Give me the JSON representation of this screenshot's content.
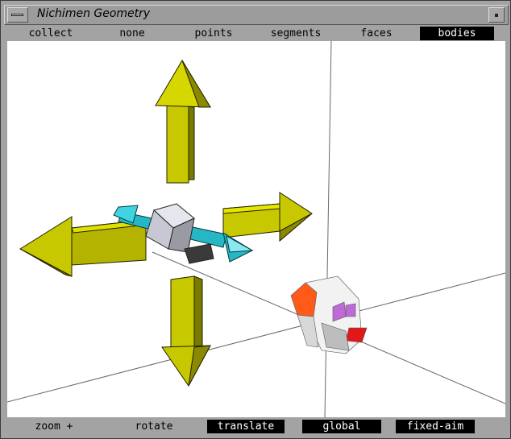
{
  "window": {
    "title": "Nichimen Geometry"
  },
  "select_bar": [
    {
      "label": "collect",
      "active": false
    },
    {
      "label": "none",
      "active": false
    },
    {
      "label": "points",
      "active": false
    },
    {
      "label": "segments",
      "active": false
    },
    {
      "label": "faces",
      "active": false
    },
    {
      "label": "bodies",
      "active": true
    }
  ],
  "mode_bar": [
    {
      "label": "zoom +",
      "active": false
    },
    {
      "label": "rotate",
      "active": false
    },
    {
      "label": "translate",
      "active": true
    },
    {
      "label": "global",
      "active": true
    },
    {
      "label": "fixed-aim",
      "active": true
    }
  ],
  "colors": {
    "arrow_yellow": "#c8c800",
    "arrow_cyan": "#27b6c4",
    "head_red": "#ff5a1a",
    "lips_red": "#e01818",
    "eyes_purple": "#c06ad8"
  }
}
